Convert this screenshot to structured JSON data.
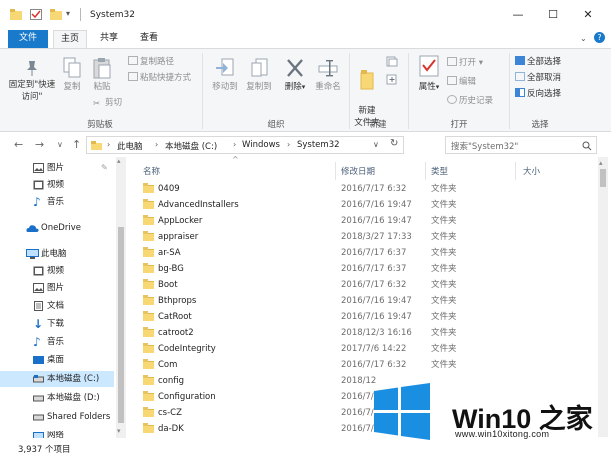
{
  "window": {
    "title": "System32",
    "controls": {
      "minimize": "—",
      "maximize": "☐",
      "close": "✕"
    }
  },
  "ribbon_tabs": [
    "文件",
    "主页",
    "共享",
    "查看"
  ],
  "ribbon": {
    "clipboard": {
      "pin_label": "固定到\"快速访问\"",
      "copy_label": "复制",
      "paste_label": "粘贴",
      "copy_path_label": "复制路径",
      "paste_shortcut_label": "粘贴快捷方式",
      "cut_label": "剪切",
      "group_label": "剪贴板"
    },
    "organize": {
      "move_to_label": "移动到",
      "copy_to_label": "复制到",
      "delete_label": "删除",
      "rename_label": "重命名",
      "group_label": "组织"
    },
    "new": {
      "new_folder_label": "新建\n文件夹",
      "group_label": "新建"
    },
    "open": {
      "properties_label": "属性",
      "open_label": "打开",
      "edit_label": "编辑",
      "history_label": "历史记录",
      "group_label": "打开"
    },
    "select": {
      "select_all_label": "全部选择",
      "select_none_label": "全部取消",
      "invert_label": "反向选择",
      "group_label": "选择"
    }
  },
  "address": {
    "crumbs": [
      "此电脑",
      "本地磁盘 (C:)",
      "Windows",
      "System32"
    ],
    "search_placeholder": "搜索\"System32\""
  },
  "nav_pane": {
    "items": [
      {
        "label": "图片",
        "icon": "pictures-icon"
      },
      {
        "label": "视频",
        "icon": "videos-icon"
      },
      {
        "label": "音乐",
        "icon": "music-icon"
      },
      {
        "label": "OneDrive",
        "icon": "onedrive-icon"
      },
      {
        "label": "此电脑",
        "icon": "this-pc-icon"
      },
      {
        "label": "视频",
        "icon": "videos-icon"
      },
      {
        "label": "图片",
        "icon": "pictures-icon"
      },
      {
        "label": "文档",
        "icon": "documents-icon"
      },
      {
        "label": "下载",
        "icon": "downloads-icon"
      },
      {
        "label": "音乐",
        "icon": "music-icon"
      },
      {
        "label": "桌面",
        "icon": "desktop-icon"
      },
      {
        "label": "本地磁盘 (C:)",
        "icon": "drive-icon"
      },
      {
        "label": "本地磁盘 (D:)",
        "icon": "drive-icon"
      },
      {
        "label": "Shared Folders",
        "icon": "drive-icon"
      },
      {
        "label": "网络",
        "icon": "network-icon"
      }
    ]
  },
  "file_list": {
    "columns": [
      "名称",
      "修改日期",
      "类型",
      "大小"
    ],
    "rows": [
      {
        "name": "0409",
        "date": "2016/7/17 6:32",
        "type": "文件夹"
      },
      {
        "name": "AdvancedInstallers",
        "date": "2016/7/16 19:47",
        "type": "文件夹"
      },
      {
        "name": "AppLocker",
        "date": "2016/7/16 19:47",
        "type": "文件夹"
      },
      {
        "name": "appraiser",
        "date": "2018/3/27 17:33",
        "type": "文件夹"
      },
      {
        "name": "ar-SA",
        "date": "2016/7/17 6:37",
        "type": "文件夹"
      },
      {
        "name": "bg-BG",
        "date": "2016/7/17 6:37",
        "type": "文件夹"
      },
      {
        "name": "Boot",
        "date": "2016/7/17 6:32",
        "type": "文件夹"
      },
      {
        "name": "Bthprops",
        "date": "2016/7/16 19:47",
        "type": "文件夹"
      },
      {
        "name": "CatRoot",
        "date": "2016/7/16 19:47",
        "type": "文件夹"
      },
      {
        "name": "catroot2",
        "date": "2018/12/3 16:16",
        "type": "文件夹"
      },
      {
        "name": "CodeIntegrity",
        "date": "2017/7/6 14:22",
        "type": "文件夹"
      },
      {
        "name": "Com",
        "date": "2016/7/17 6:32",
        "type": "文件夹"
      },
      {
        "name": "config",
        "date": "2018/12",
        "type": ""
      },
      {
        "name": "Configuration",
        "date": "2016/7/",
        "type": ""
      },
      {
        "name": "cs-CZ",
        "date": "2016/7/",
        "type": ""
      },
      {
        "name": "da-DK",
        "date": "2016/7/",
        "type": ""
      }
    ]
  },
  "status": {
    "item_count": "3,937 个项目"
  },
  "watermark": {
    "title": "Win10 之家",
    "url": "www.win10xitong.com",
    "brand_color": "#1a8ee1"
  }
}
